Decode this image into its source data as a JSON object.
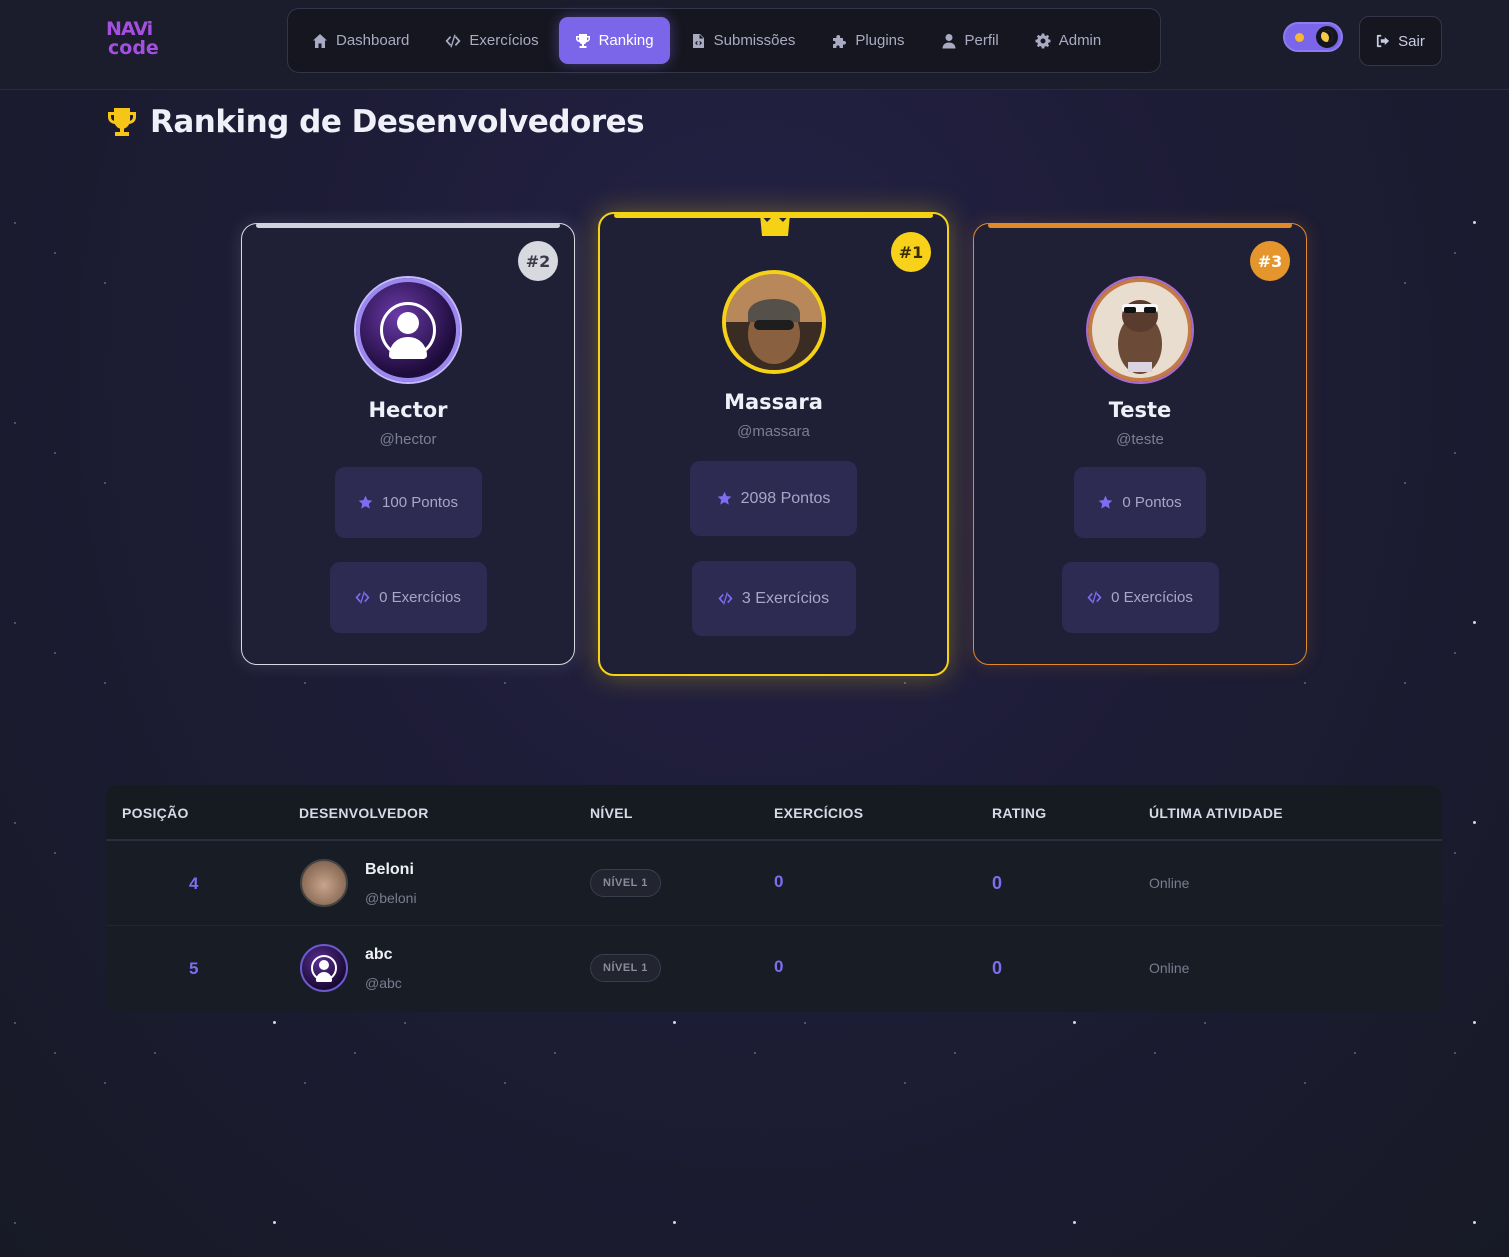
{
  "app": {
    "logo_line1": "NAVi",
    "logo_line2": "code"
  },
  "nav": {
    "items": [
      {
        "label": "Dashboard",
        "icon": "home-icon",
        "active": false
      },
      {
        "label": "Exercícios",
        "icon": "code-icon",
        "active": false
      },
      {
        "label": "Ranking",
        "icon": "trophy-icon",
        "active": true
      },
      {
        "label": "Submissões",
        "icon": "file-icon",
        "active": false
      },
      {
        "label": "Plugins",
        "icon": "puzzle-icon",
        "active": false
      },
      {
        "label": "Perfil",
        "icon": "user-icon",
        "active": false
      },
      {
        "label": "Admin",
        "icon": "gear-icon",
        "active": false
      }
    ],
    "logout_label": "Sair"
  },
  "page": {
    "title": "Ranking de Desenvolvedores"
  },
  "podium": {
    "first": {
      "rank": "#1",
      "name": "Massara",
      "handle": "@massara",
      "points": "2098 Pontos",
      "exercises": "3 Exercícios"
    },
    "second": {
      "rank": "#2",
      "name": "Hector",
      "handle": "@hector",
      "points": "100 Pontos",
      "exercises": "0 Exercícios"
    },
    "third": {
      "rank": "#3",
      "name": "Teste",
      "handle": "@teste",
      "points": "0 Pontos",
      "exercises": "0 Exercícios"
    }
  },
  "table": {
    "headers": [
      "POSIÇÃO",
      "DESENVOLVEDOR",
      "NÍVEL",
      "EXERCÍCIOS",
      "RATING",
      "ÚLTIMA ATIVIDADE"
    ],
    "rows": [
      {
        "position": "4",
        "name": "Beloni",
        "handle": "@beloni",
        "level": "NÍVEL 1",
        "exercises": "0",
        "rating": "0",
        "last_activity": "Online"
      },
      {
        "position": "5",
        "name": "abc",
        "handle": "@abc",
        "level": "NÍVEL 1",
        "exercises": "0",
        "rating": "0",
        "last_activity": "Online"
      }
    ]
  },
  "colors": {
    "accent": "#7b66ea",
    "gold": "#f5d215",
    "silver": "#d9d9e2",
    "bronze": "#e08a2a",
    "background": "#1d1c36"
  }
}
